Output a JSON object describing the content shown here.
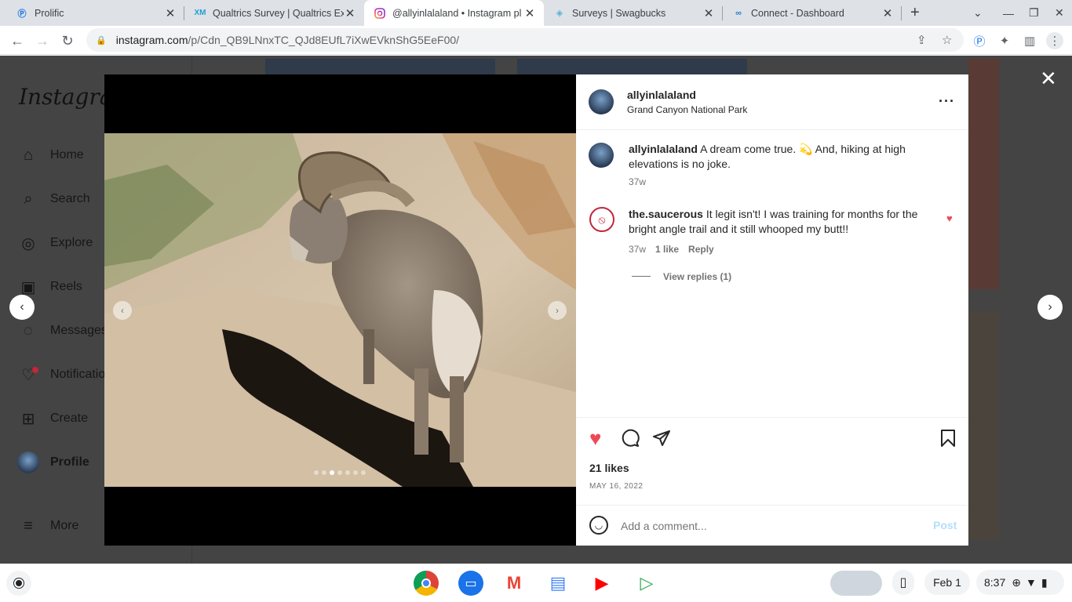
{
  "tabs": [
    {
      "title": "Prolific",
      "favicon": "prolific-icon"
    },
    {
      "title": "Qualtrics Survey | Qualtrics Exp",
      "favicon": "qualtrics-icon"
    },
    {
      "title": "@allyinlalaland • Instagram pl",
      "favicon": "instagram-icon"
    },
    {
      "title": "Surveys | Swagbucks",
      "favicon": "swagbucks-icon"
    },
    {
      "title": "Connect - Dashboard",
      "favicon": "connect-icon"
    }
  ],
  "address": {
    "host": "instagram.com",
    "path": "/p/Cdn_QB9LNnxTC_QJd8EUfL7iXwEVknShG5EeF00/"
  },
  "sidebar": {
    "logo": "Instagram",
    "items": [
      {
        "label": "Home",
        "icon": "home-icon"
      },
      {
        "label": "Search",
        "icon": "search-icon"
      },
      {
        "label": "Explore",
        "icon": "compass-icon"
      },
      {
        "label": "Reels",
        "icon": "reels-icon"
      },
      {
        "label": "Messages",
        "icon": "messenger-icon"
      },
      {
        "label": "Notifications",
        "icon": "heart-icon"
      },
      {
        "label": "Create",
        "icon": "plus-square-icon"
      },
      {
        "label": "Profile",
        "icon": "avatar"
      }
    ],
    "more": "More"
  },
  "post": {
    "username": "allyinlalaland",
    "location": "Grand Canyon National Park",
    "caption_user": "allyinlalaland",
    "caption_text": "A dream come true. 💫 And, hiking at high elevations is no joke.",
    "caption_age": "37w",
    "comment": {
      "user": "the.saucerous",
      "text": "It legit isn't! I was training for months for the bright angle trail and it still whooped my butt!!",
      "age": "37w",
      "likes": "1 like",
      "reply": "Reply",
      "view_replies": "View replies (1)"
    },
    "likes": "21 likes",
    "date": "MAY 16, 2022",
    "add_comment_placeholder": "Add a comment...",
    "post_button": "Post",
    "carousel": {
      "count": 7,
      "active_index": 2
    }
  },
  "shelf": {
    "date": "Feb 1",
    "time": "8:37"
  },
  "colors": {
    "like_red": "#ed4956",
    "post_blue": "#b2dffc",
    "instagram_gradient": "#d6249f"
  }
}
